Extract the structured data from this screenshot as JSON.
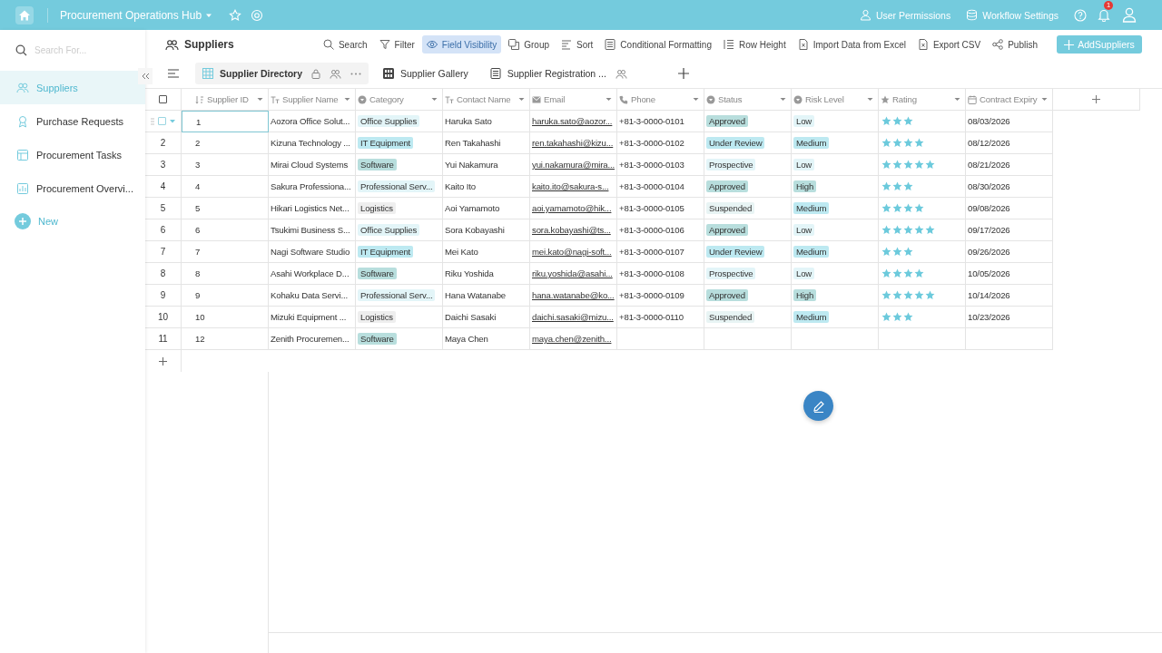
{
  "app_bar": {
    "title": "Procurement Operations Hub",
    "links": [
      "User Permissions",
      "Workflow Settings"
    ],
    "notification_count": "1"
  },
  "sidebar": {
    "search": {
      "placeholder": "Search For..."
    },
    "items": [
      {
        "label": "Suppliers",
        "selected": true
      },
      {
        "label": "Purchase Requests",
        "selected": false
      },
      {
        "label": "Procurement Tasks",
        "selected": false
      },
      {
        "label": "Procurement Overvi...",
        "selected": false
      }
    ],
    "new_label": "New"
  },
  "page_title": "Suppliers",
  "toolbar": [
    {
      "label": "Search",
      "selected": false
    },
    {
      "label": "Filter",
      "selected": false
    },
    {
      "label": "Field Visibility",
      "selected": true
    },
    {
      "label": "Group",
      "selected": false
    },
    {
      "label": "Sort",
      "selected": false
    },
    {
      "label": "Conditional Formatting",
      "selected": false
    },
    {
      "label": "Row Height",
      "selected": false
    },
    {
      "label": "Import Data from Excel",
      "selected": false
    },
    {
      "label": "Export CSV",
      "selected": false
    },
    {
      "label": "Publish",
      "selected": false
    }
  ],
  "add_button": "AddSuppliers",
  "views": [
    {
      "label": "Supplier Directory",
      "selected": true
    },
    {
      "label": "Supplier Gallery",
      "selected": false
    },
    {
      "label": "Supplier Registration ...",
      "selected": false
    }
  ],
  "table": {
    "select_all_checked": false,
    "columns": [
      "Supplier ID",
      "Supplier Name",
      "Category",
      "Contact Name",
      "Email",
      "Phone",
      "Status",
      "Risk Level",
      "Rating",
      "Contract Expiry"
    ],
    "rows": [
      {
        "hovered": true,
        "id": "1",
        "name": "Aozora Office Solut...",
        "category": {
          "text": "Office Supplies",
          "color": "#e3f5f8"
        },
        "contact": "Haruka Sato",
        "email": "haruka.sato@aozor...",
        "phone": "+81-3-0000-0101",
        "status": {
          "text": "Approved",
          "color": "#b8dedd"
        },
        "risk": {
          "text": "Low",
          "color": "#e3f5f8"
        },
        "stars": 3,
        "expiry": "08/03/2026"
      },
      {
        "hovered": false,
        "number": "2",
        "id": "2",
        "name": "Kizuna Technology ...",
        "category": {
          "text": "IT Equipment",
          "color": "#bde9f1"
        },
        "contact": "Ren Takahashi",
        "email": "ren.takahashi@kizu...",
        "phone": "+81-3-0000-0102",
        "status": {
          "text": "Under Review",
          "color": "#bde9f1"
        },
        "risk": {
          "text": "Medium",
          "color": "#bde9f1"
        },
        "stars": 4,
        "expiry": "08/12/2026"
      },
      {
        "hovered": false,
        "number": "3",
        "id": "3",
        "name": "Mirai Cloud Systems",
        "category": {
          "text": "Software",
          "color": "#b8dedd"
        },
        "contact": "Yui Nakamura",
        "email": "yui.nakamura@mira...",
        "phone": "+81-3-0000-0103",
        "status": {
          "text": "Prospective",
          "color": "#e3f5f8"
        },
        "risk": {
          "text": "Low",
          "color": "#e3f5f8"
        },
        "stars": 5,
        "expiry": "08/21/2026"
      },
      {
        "hovered": false,
        "number": "4",
        "id": "4",
        "name": "Sakura Professiona...",
        "category": {
          "text": "Professional Serv...",
          "color": "#e3f5f8"
        },
        "contact": "Kaito Ito",
        "email": "kaito.ito@sakura-s...",
        "phone": "+81-3-0000-0104",
        "status": {
          "text": "Approved",
          "color": "#b8dedd"
        },
        "risk": {
          "text": "High",
          "color": "#b8dedd"
        },
        "stars": 3,
        "expiry": "08/30/2026"
      },
      {
        "hovered": false,
        "number": "5",
        "id": "5",
        "name": "Hikari Logistics Net...",
        "category": {
          "text": "Logistics",
          "color": "#eeeeee"
        },
        "contact": "Aoi Yamamoto",
        "email": "aoi.yamamoto@hik...",
        "phone": "+81-3-0000-0105",
        "status": {
          "text": "Suspended",
          "color": "#e8f4f4"
        },
        "risk": {
          "text": "Medium",
          "color": "#bde9f1"
        },
        "stars": 4,
        "expiry": "09/08/2026"
      },
      {
        "hovered": false,
        "number": "6",
        "id": "6",
        "name": "Tsukimi Business S...",
        "category": {
          "text": "Office Supplies",
          "color": "#e3f5f8"
        },
        "contact": "Sora Kobayashi",
        "email": "sora.kobayashi@ts...",
        "phone": "+81-3-0000-0106",
        "status": {
          "text": "Approved",
          "color": "#b8dedd"
        },
        "risk": {
          "text": "Low",
          "color": "#e3f5f8"
        },
        "stars": 5,
        "expiry": "09/17/2026"
      },
      {
        "hovered": false,
        "number": "7",
        "id": "7",
        "name": "Nagi Software Studio",
        "category": {
          "text": "IT Equipment",
          "color": "#bde9f1"
        },
        "contact": "Mei Kato",
        "email": "mei.kato@nagi-soft...",
        "phone": "+81-3-0000-0107",
        "status": {
          "text": "Under Review",
          "color": "#bde9f1"
        },
        "risk": {
          "text": "Medium",
          "color": "#bde9f1"
        },
        "stars": 3,
        "expiry": "09/26/2026"
      },
      {
        "hovered": false,
        "number": "8",
        "id": "8",
        "name": "Asahi Workplace D...",
        "category": {
          "text": "Software",
          "color": "#b8dedd"
        },
        "contact": "Riku Yoshida",
        "email": "riku.yoshida@asahi...",
        "phone": "+81-3-0000-0108",
        "status": {
          "text": "Prospective",
          "color": "#e3f5f8"
        },
        "risk": {
          "text": "Low",
          "color": "#e3f5f8"
        },
        "stars": 4,
        "expiry": "10/05/2026"
      },
      {
        "hovered": false,
        "number": "9",
        "id": "9",
        "name": "Kohaku Data Servi...",
        "category": {
          "text": "Professional Serv...",
          "color": "#e3f5f8"
        },
        "contact": "Hana Watanabe",
        "email": "hana.watanabe@ko...",
        "phone": "+81-3-0000-0109",
        "status": {
          "text": "Approved",
          "color": "#b8dedd"
        },
        "risk": {
          "text": "High",
          "color": "#b8dedd"
        },
        "stars": 5,
        "expiry": "10/14/2026"
      },
      {
        "hovered": false,
        "number": "10",
        "id": "10",
        "name": "Mizuki Equipment ...",
        "category": {
          "text": "Logistics",
          "color": "#eeeeee"
        },
        "contact": "Daichi Sasaki",
        "email": "daichi.sasaki@mizu...",
        "phone": "+81-3-0000-0110",
        "status": {
          "text": "Suspended",
          "color": "#e8f4f4"
        },
        "risk": {
          "text": "Medium",
          "color": "#bde9f1"
        },
        "stars": 3,
        "expiry": "10/23/2026"
      },
      {
        "hovered": false,
        "number": "11",
        "id": "12",
        "name": "Zenith Procuremen...",
        "category": {
          "text": "Software",
          "color": "#b8dedd"
        },
        "contact": "Maya Chen",
        "email": "maya.chen@zenith..."
      }
    ]
  }
}
